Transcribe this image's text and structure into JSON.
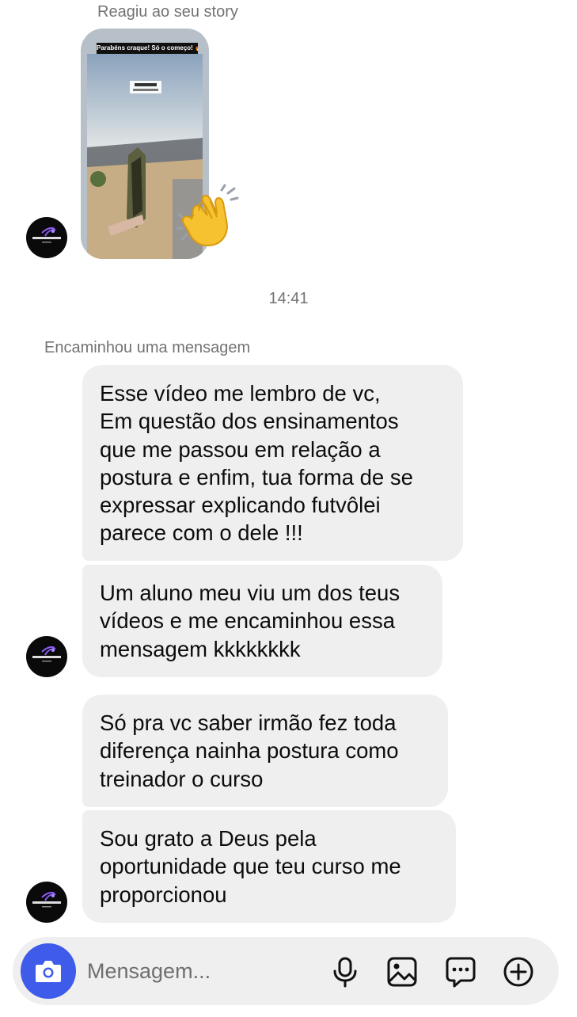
{
  "conversation": {
    "reacted_label": "Reagiu ao seu story",
    "story_banner": "Parabéns craque! Só o começo! 🔥⚽🧠",
    "story_reaction": "clapping-hands",
    "timestamp": "14:41",
    "forwarded_label": "Encaminhou uma mensagem",
    "messages": [
      {
        "text": "Esse vídeo me lembro de vc,\nEm questão dos ensinamentos\nque me passou em relação a\npostura e enfim, tua forma de se\nexpressar explicando futvôlei\nparece com o dele !!!"
      },
      {
        "text": "Um aluno meu viu um dos teus\nvídeos e me encaminhou essa\nmensagem kkkkkkkk"
      },
      {
        "text": "Só pra vc saber irmão fez toda\ndiferença nainha postura como\ntreinador o curso"
      },
      {
        "text": "Sou grato a Deus pela\noportunidade que teu curso me\nproporcionou"
      }
    ]
  },
  "composer": {
    "placeholder": "Mensagem...",
    "icons": [
      "camera-icon",
      "mic-icon",
      "image-icon",
      "sticker-icon",
      "plus-icon"
    ],
    "accent_color": "#3e5bea"
  }
}
